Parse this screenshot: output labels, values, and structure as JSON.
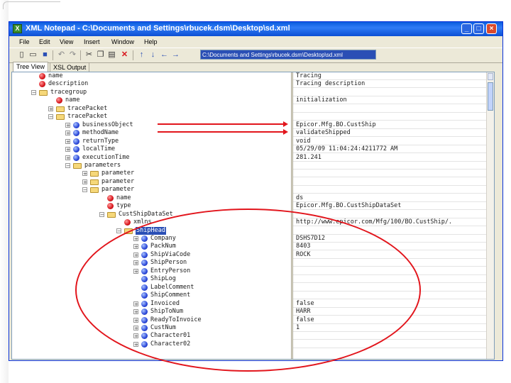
{
  "window": {
    "title": "XML Notepad - C:\\Documents and Settings\\rbucek.dsm\\Desktop\\sd.xml",
    "app_icon": "xml-notepad-icon",
    "controls": [
      "minimize",
      "maximize",
      "close"
    ]
  },
  "menu": [
    "File",
    "Edit",
    "View",
    "Insert",
    "Window",
    "Help"
  ],
  "toolbar": {
    "tools": [
      "new-icon",
      "open-icon",
      "save-icon",
      "undo-icon",
      "redo-icon",
      "cut-icon",
      "copy-icon",
      "paste-icon",
      "delete-icon",
      "nudge-up-icon",
      "nudge-down-icon",
      "nudge-left-icon",
      "nudge-right-icon"
    ],
    "path": "C:\\Documents and Settings\\rbucek.dsm\\Desktop\\sd.xml"
  },
  "tabs": [
    {
      "label": "Tree View",
      "active": true
    },
    {
      "label": "XSL Output",
      "active": false
    }
  ],
  "tree": [
    {
      "label": "name",
      "icon": "attribute-icon",
      "level": 2,
      "exp": ""
    },
    {
      "label": "description",
      "icon": "attribute-icon",
      "level": 2,
      "exp": ""
    },
    {
      "label": "tracegroup",
      "icon": "folder-icon",
      "level": 2,
      "exp": "-"
    },
    {
      "label": "name",
      "icon": "attribute-icon",
      "level": 3,
      "exp": ""
    },
    {
      "label": "tracePacket",
      "icon": "folder-icon",
      "level": 3,
      "exp": "+"
    },
    {
      "label": "tracePacket",
      "icon": "folder-icon",
      "level": 3,
      "exp": "-"
    },
    {
      "label": "businessObject",
      "icon": "element-icon",
      "level": 4,
      "exp": "+"
    },
    {
      "label": "methodName",
      "icon": "element-icon",
      "level": 4,
      "exp": "+"
    },
    {
      "label": "returnType",
      "icon": "element-icon",
      "level": 4,
      "exp": "+"
    },
    {
      "label": "localTime",
      "icon": "element-icon",
      "level": 4,
      "exp": "+"
    },
    {
      "label": "executionTime",
      "icon": "element-icon",
      "level": 4,
      "exp": "+"
    },
    {
      "label": "parameters",
      "icon": "folder-icon",
      "level": 4,
      "exp": "-"
    },
    {
      "label": "parameter",
      "icon": "folder-icon",
      "level": 5,
      "exp": "+"
    },
    {
      "label": "parameter",
      "icon": "folder-icon",
      "level": 5,
      "exp": "+"
    },
    {
      "label": "parameter",
      "icon": "folder-icon",
      "level": 5,
      "exp": "-"
    },
    {
      "label": "name",
      "icon": "attribute-icon",
      "level": 6,
      "exp": ""
    },
    {
      "label": "type",
      "icon": "attribute-icon",
      "level": 6,
      "exp": ""
    },
    {
      "label": "CustShipDataSet",
      "icon": "folder-icon",
      "level": 6,
      "exp": "-"
    },
    {
      "label": "xmlns",
      "icon": "attribute-icon",
      "level": 7,
      "exp": ""
    },
    {
      "label": "ShipHead",
      "icon": "folder-icon",
      "level": 7,
      "exp": "-",
      "selected": true
    },
    {
      "label": "Company",
      "icon": "element-icon",
      "level": 8,
      "exp": "+"
    },
    {
      "label": "PackNum",
      "icon": "element-icon",
      "level": 8,
      "exp": "+"
    },
    {
      "label": "ShipViaCode",
      "icon": "element-icon",
      "level": 8,
      "exp": "+"
    },
    {
      "label": "ShipPerson",
      "icon": "element-icon",
      "level": 8,
      "exp": "+"
    },
    {
      "label": "EntryPerson",
      "icon": "element-icon",
      "level": 8,
      "exp": "+"
    },
    {
      "label": "ShipLog",
      "icon": "element-icon",
      "level": 8,
      "exp": ""
    },
    {
      "label": "LabelComment",
      "icon": "element-icon",
      "level": 8,
      "exp": ""
    },
    {
      "label": "ShipComment",
      "icon": "element-icon",
      "level": 8,
      "exp": ""
    },
    {
      "label": "Invoiced",
      "icon": "element-icon",
      "level": 8,
      "exp": "+"
    },
    {
      "label": "ShipToNum",
      "icon": "element-icon",
      "level": 8,
      "exp": "+"
    },
    {
      "label": "ReadyToInvoice",
      "icon": "element-icon",
      "level": 8,
      "exp": "+"
    },
    {
      "label": "CustNum",
      "icon": "element-icon",
      "level": 8,
      "exp": "+"
    },
    {
      "label": "Character01",
      "icon": "element-icon",
      "level": 8,
      "exp": "+"
    },
    {
      "label": "Character02",
      "icon": "element-icon",
      "level": 8,
      "exp": "+"
    }
  ],
  "values": [
    "Tracing",
    "Tracing description",
    "",
    "initialization",
    "",
    "",
    "Epicor.Mfg.BO.CustShip",
    "validateShipped",
    "void",
    "05/29/09 11:04:24:4211772 AM",
    "281.241",
    "",
    "",
    "",
    "",
    "ds",
    "Epicor.Mfg.BO.CustShipDataSet",
    "",
    "http://www.epicor.com/Mfg/100/BO.CustShip/.",
    "",
    "DSHS7D12",
    "8403",
    "ROCK",
    "",
    "",
    "",
    "",
    "",
    "false",
    "HARR",
    "false",
    "1",
    "",
    ""
  ],
  "annotations": {
    "color": "#e2151c",
    "arrows": [
      "businessObject",
      "methodName"
    ],
    "highlight": "ellipse"
  }
}
